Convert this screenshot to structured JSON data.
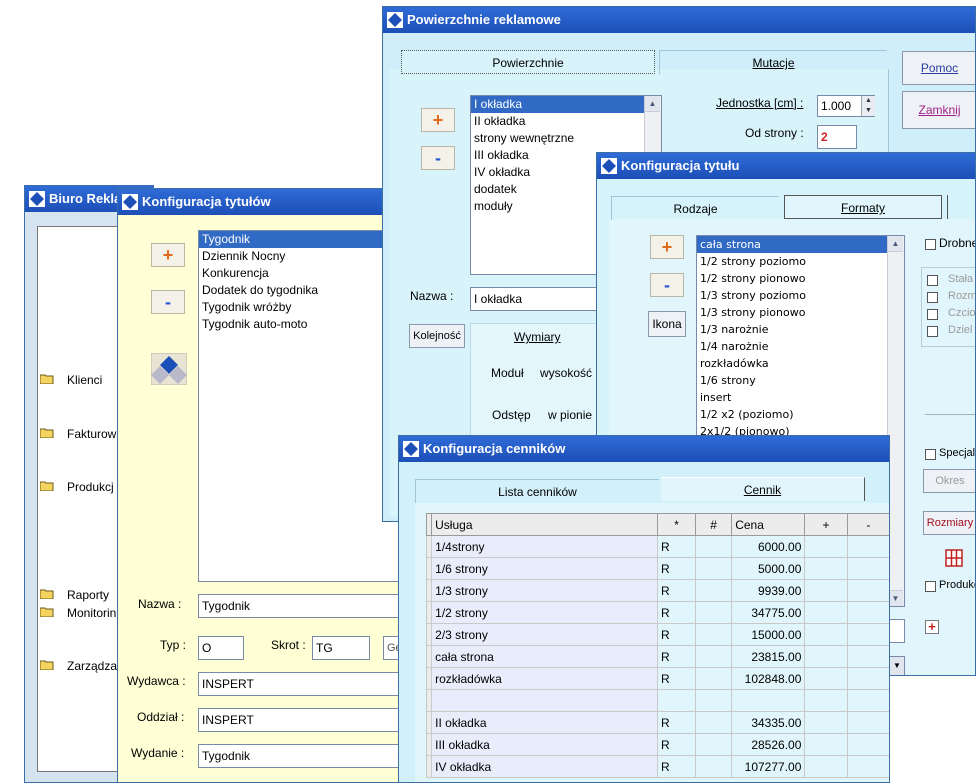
{
  "biuro": {
    "title": "Biuro Rekla",
    "menu": [
      "Klienci",
      "Fakturow",
      "Produkcj",
      "Raporty",
      "Monitorin",
      "Zarządza"
    ]
  },
  "konf_tytulow": {
    "title": "Konfiguracja tytułów",
    "plus": "+",
    "minus": "-",
    "list": [
      "Tygodnik",
      "Dziennik Nocny",
      "Konkurencja",
      "Dodatek do tygodnika",
      "Tygodnik wróżby",
      "Tygodnik auto-moto"
    ],
    "nazwa_label": "Nazwa :",
    "nazwa_value": "Tygodnik",
    "typ_label": "Typ :",
    "typ_value": "O",
    "skrot_label": "Skrot :",
    "skrot_value": "TG",
    "extra_value": "Ge",
    "wydawca_label": "Wydawca :",
    "wydawca_value": "INSPERT",
    "oddzial_label": "Oddział :",
    "oddzial_value": "INSPERT",
    "wydanie_label": "Wydanie :",
    "wydanie_value": "Tygodnik"
  },
  "powierzchnie": {
    "title": "Powierzchnie reklamowe",
    "tab_active": "Powierzchnie",
    "tab_other": "Mutacje",
    "pomoc": "Pomoc",
    "zamknij": "Zamknij",
    "plus": "+",
    "minus": "-",
    "list": [
      "I okładka",
      "II okładka",
      "strony wewnętrzne",
      "III okładka",
      "IV okładka",
      "dodatek",
      "moduły"
    ],
    "jednostka_label": "Jednostka [cm] :",
    "jednostka_value": "1.000",
    "od_strony_label": "Od strony :",
    "od_strony_value": "2",
    "nazwa_label": "Nazwa :",
    "nazwa_value": "I okładka",
    "kolejnosc": "Kolejność",
    "wymiary": "Wymiary",
    "modul": "Moduł",
    "wysokosc": "wysokość",
    "odstep": "Odstęp",
    "w_pionie": "w pionie"
  },
  "konf_tytulu": {
    "title": "Konfiguracja tytułu",
    "tab_rodzaje": "Rodzaje",
    "tab_formaty": "Formaty",
    "plus": "+",
    "minus": "-",
    "ikona": "Ikona",
    "list": [
      "cała strona",
      "1/2 strony poziomo",
      "1/2 strony pionowo",
      "1/3 strony poziomo",
      "1/3 strony pionowo",
      "1/3 narożnie",
      "1/4 narożnie",
      "rozkładówka",
      "1/6 strony",
      "insert",
      "1/2 x2 (poziomo)",
      "2x1/2 (pionowo)"
    ],
    "drobne": "Drobne",
    "checks": [
      "Stała",
      "Rozm",
      "Czcio",
      "Dziel"
    ],
    "specjalne": "Specjaln",
    "okres": "Okres",
    "rozmiary": "Rozmiary",
    "produkcja": "Produkc"
  },
  "cenniki": {
    "title": "Konfiguracja cenników",
    "tab_lista": "Lista cenników",
    "tab_cennik": "Cennik",
    "headers": [
      "Usługa",
      "*",
      "#",
      "Cena",
      "+",
      "-"
    ],
    "rows": [
      {
        "usluga": "1/4strony",
        "typ": "R",
        "cena": "6000.00"
      },
      {
        "usluga": "1/6 strony",
        "typ": "R",
        "cena": "5000.00"
      },
      {
        "usluga": "1/3 strony",
        "typ": "R",
        "cena": "9939.00"
      },
      {
        "usluga": "1/2 strony",
        "typ": "R",
        "cena": "34775.00"
      },
      {
        "usluga": "2/3 strony",
        "typ": "R",
        "cena": "15000.00"
      },
      {
        "usluga": "cała strona",
        "typ": "R",
        "cena": "23815.00"
      },
      {
        "usluga": "rozkładówka",
        "typ": "R",
        "cena": "102848.00"
      },
      {
        "usluga": "",
        "typ": "",
        "cena": ""
      },
      {
        "usluga": "II okładka",
        "typ": "R",
        "cena": "34335.00"
      },
      {
        "usluga": "III okładka",
        "typ": "R",
        "cena": "28526.00"
      },
      {
        "usluga": "IV okładka",
        "typ": "R",
        "cena": "107277.00"
      }
    ]
  }
}
